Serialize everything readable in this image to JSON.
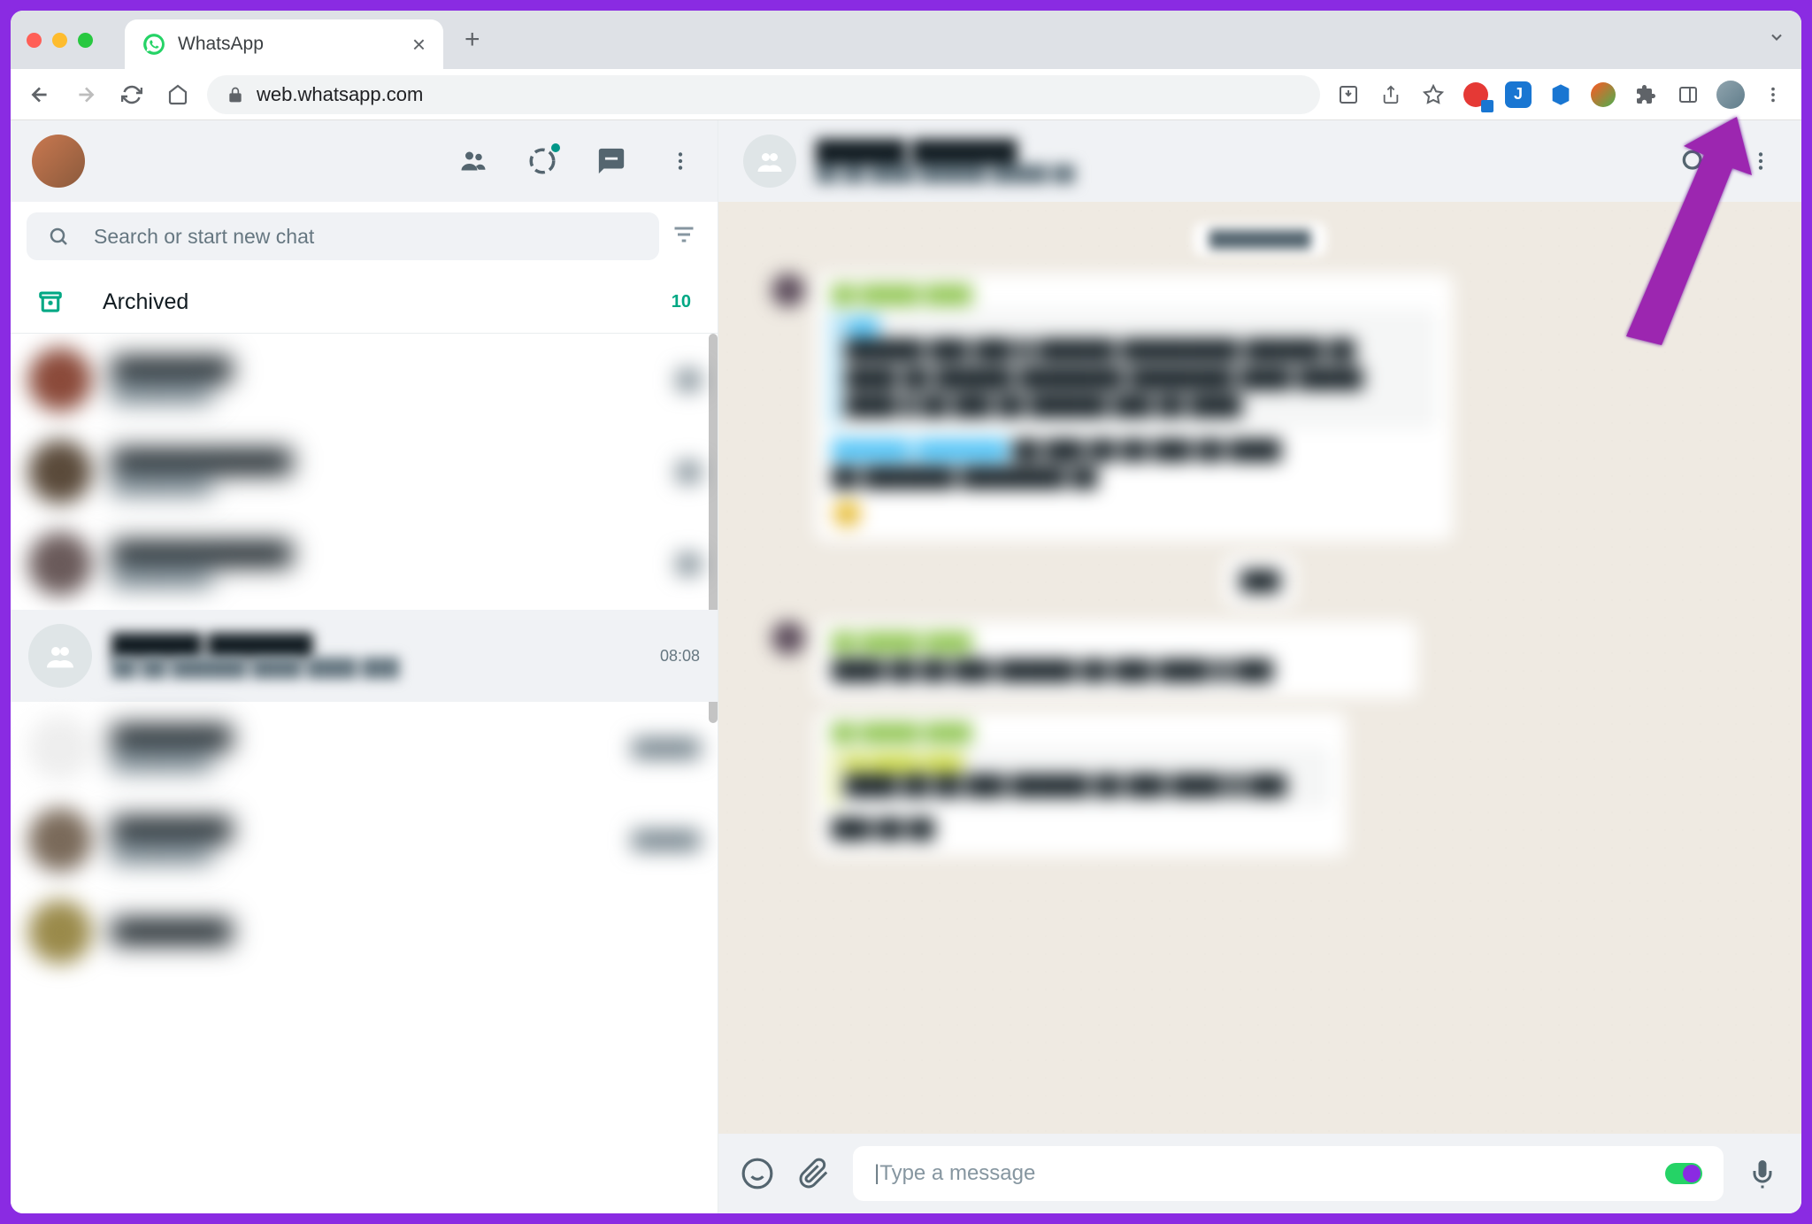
{
  "browser": {
    "tab_title": "WhatsApp",
    "url": "web.whatsapp.com",
    "url_prefix_secure": true
  },
  "left_panel": {
    "search_placeholder": "Search or start new chat",
    "archived_label": "Archived",
    "archived_count": "10",
    "selected_chat_time": "08:08"
  },
  "right_panel": {
    "message_input_placeholder": "Type a message"
  }
}
